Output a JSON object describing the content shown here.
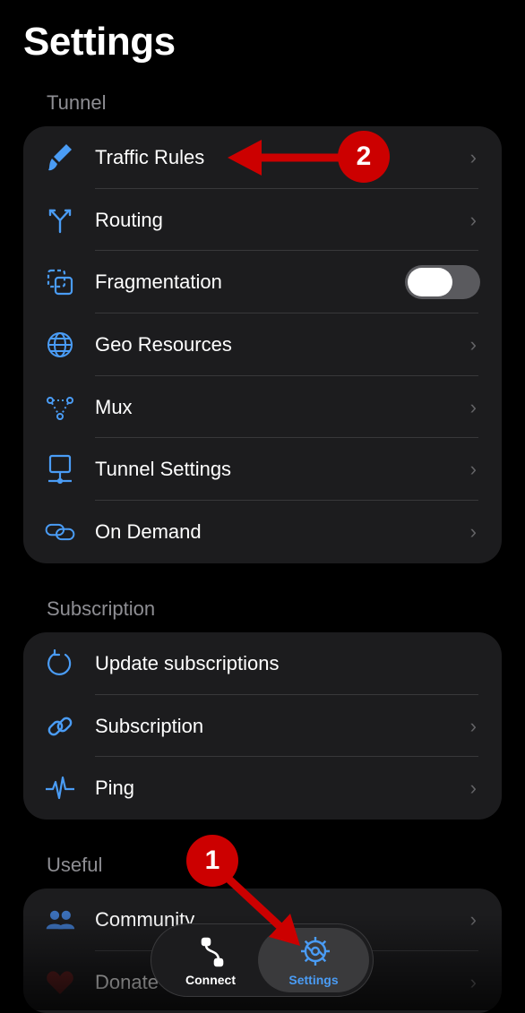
{
  "page": {
    "title": "Settings"
  },
  "colors": {
    "accent": "#4a9cf5",
    "annotation": "#cc0000",
    "heart": "#5a1e1e",
    "community": "#3b6fb8"
  },
  "sections": [
    {
      "label": "Tunnel",
      "items": [
        {
          "icon": "paintbrush-icon",
          "label": "Traffic Rules",
          "control": "chevron"
        },
        {
          "icon": "fork-arrows-icon",
          "label": "Routing",
          "control": "chevron"
        },
        {
          "icon": "fragment-squares-icon",
          "label": "Fragmentation",
          "control": "toggle",
          "toggle_on": false
        },
        {
          "icon": "globe-icon",
          "label": "Geo Resources",
          "control": "chevron"
        },
        {
          "icon": "mux-nodes-icon",
          "label": "Mux",
          "control": "chevron"
        },
        {
          "icon": "monitor-network-icon",
          "label": "Tunnel Settings",
          "control": "chevron"
        },
        {
          "icon": "chain-link-icon",
          "label": "On Demand",
          "control": "chevron"
        }
      ]
    },
    {
      "label": "Subscription",
      "items": [
        {
          "icon": "refresh-icon",
          "label": "Update subscriptions",
          "control": "none"
        },
        {
          "icon": "link-icon",
          "label": "Subscription",
          "control": "chevron"
        },
        {
          "icon": "waveform-icon",
          "label": "Ping",
          "control": "chevron"
        }
      ]
    },
    {
      "label": "Useful",
      "items": [
        {
          "icon": "people-icon",
          "label": "Community",
          "control": "chevron"
        },
        {
          "icon": "heart-icon",
          "label": "Donate",
          "control": "chevron"
        }
      ]
    }
  ],
  "tabbar": {
    "connect_label": "Connect",
    "settings_label": "Settings",
    "selected": "Settings"
  },
  "annotations": {
    "step1": "1",
    "step2": "2"
  },
  "chevron_glyph": "›"
}
